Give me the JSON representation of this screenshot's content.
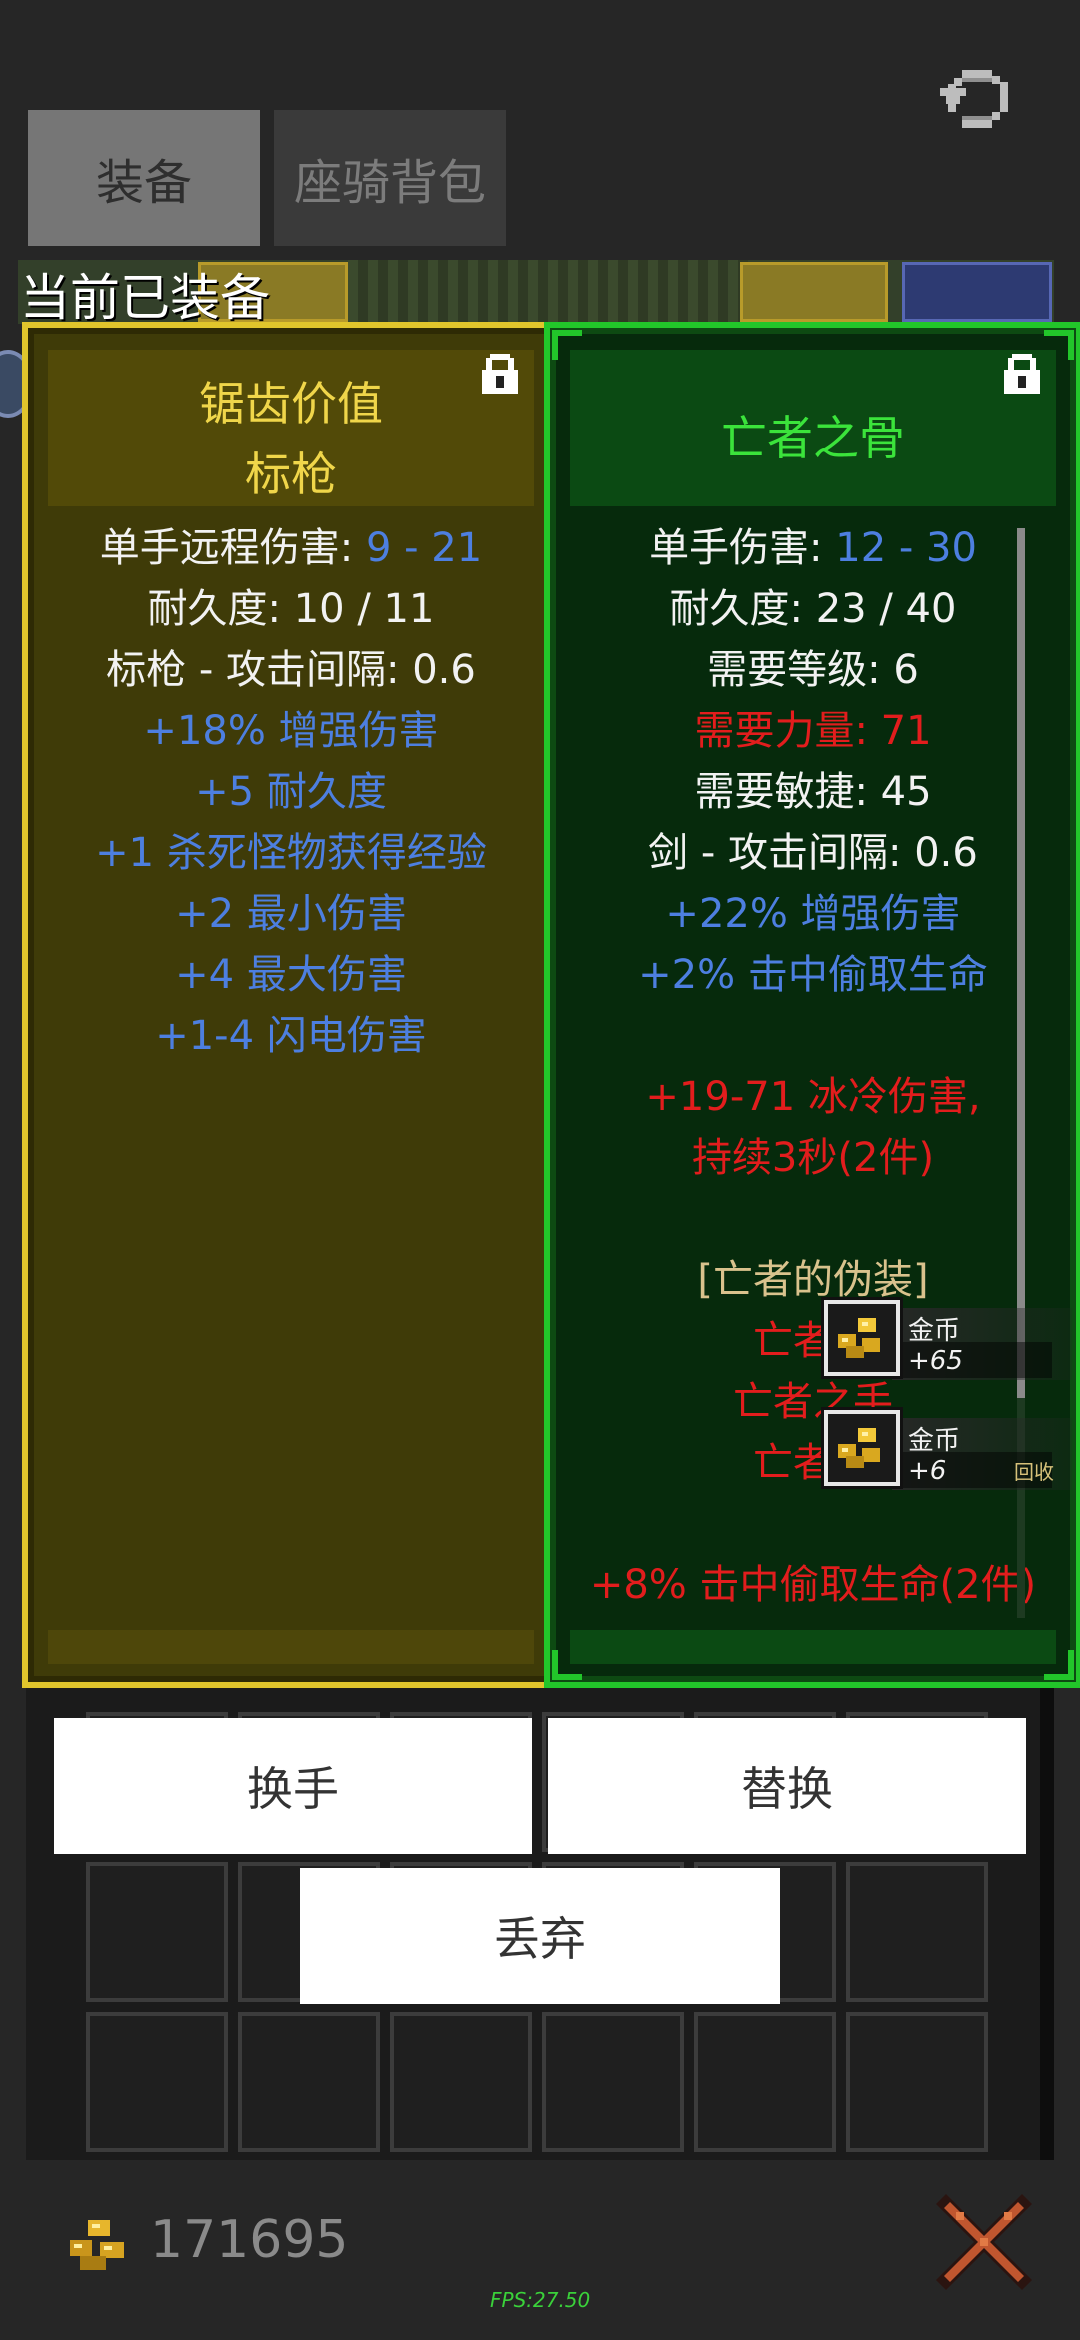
{
  "tabs": [
    {
      "label": "装备",
      "active": true
    },
    {
      "label": "座骑背包",
      "active": false
    }
  ],
  "equipped_label": "当前已装备",
  "left_item": {
    "title_line1": "锯齿价值",
    "title_line2": "标枪",
    "title_color": "#f0d64a",
    "stats": [
      {
        "label": "单手远程伤害: ",
        "value": "9 - 21"
      },
      {
        "text": "耐久度: 10 / 11"
      },
      {
        "text": "标枪 - 攻击间隔: 0.6"
      },
      {
        "text": "+18% 增强伤害"
      },
      {
        "text": "+5 耐久度"
      },
      {
        "text": "+1 杀死怪物获得经验"
      },
      {
        "text": "+2 最小伤害"
      },
      {
        "text": "+4 最大伤害"
      },
      {
        "text": "+1-4 闪电伤害"
      }
    ]
  },
  "right_item": {
    "title": "亡者之骨",
    "title_color": "#3be43b",
    "stats": [
      {
        "label": "单手伤害: ",
        "value": "12 - 30"
      },
      {
        "text": "耐久度: 23 / 40"
      },
      {
        "text": "需要等级: 6"
      },
      {
        "text": "需要力量: 71"
      },
      {
        "text": "需要敏捷: 45"
      },
      {
        "text": "剑 - 攻击间隔: 0.6"
      },
      {
        "text": "+22% 增强伤害"
      },
      {
        "text": "+2% 击中偷取生命"
      },
      {
        "text": "+19-71 冰冷伤害,"
      },
      {
        "text": "持续3秒(2件)"
      },
      {
        "text": "[亡者的伪装]"
      },
      {
        "text": "亡者之"
      },
      {
        "text": "亡者之手"
      },
      {
        "text": "亡者之"
      },
      {
        "text": "+8% 击中偷取生命(2件)"
      }
    ]
  },
  "pickups": [
    {
      "name": "金币",
      "amount": "+65"
    },
    {
      "name": "金币",
      "amount": "+6"
    }
  ],
  "recycle_label": "回收",
  "buttons": {
    "swap_hand": "换手",
    "replace": "替换",
    "discard": "丢弃"
  },
  "gold": "171695",
  "fps": "FPS:27.50",
  "colors": {
    "left_border": "#e0c52c",
    "right_border": "#22c62a",
    "blue_stat": "#4d7fe0",
    "red_stat": "#e21d1d"
  }
}
